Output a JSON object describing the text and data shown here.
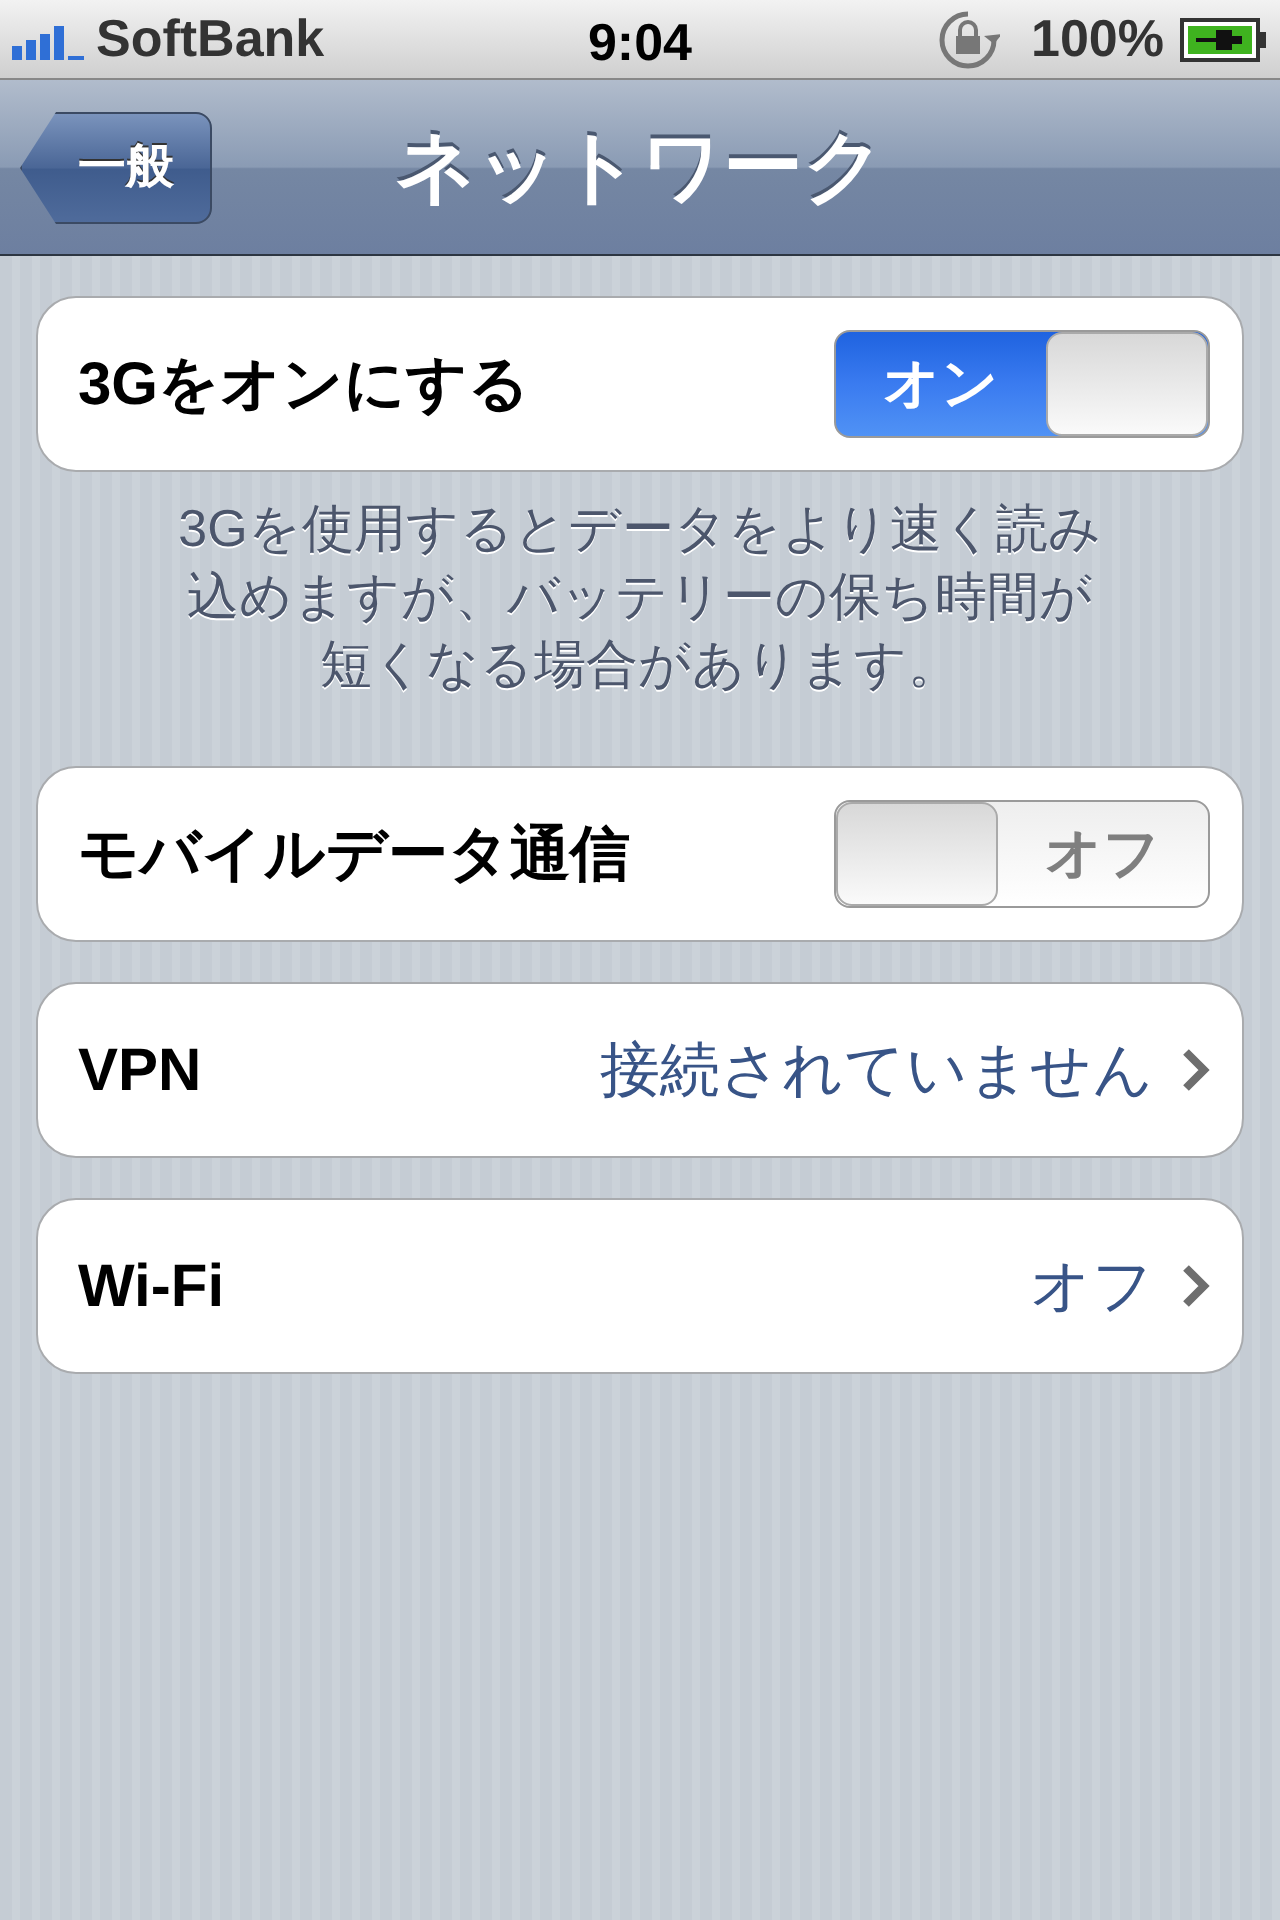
{
  "status_bar": {
    "carrier": "SoftBank",
    "time": "9:04",
    "battery": "100%"
  },
  "nav_bar": {
    "back": "一般",
    "title": "ネットワーク"
  },
  "groups": [
    {
      "rows": [
        {
          "kind": "toggle",
          "label": "3Gをオンにする",
          "on": true,
          "state_text": "オン"
        }
      ],
      "footer": "3Gを使用するとデータをより速く読み込めますが、バッテリーの保ち時間が短くなる場合があります。"
    },
    {
      "rows": [
        {
          "kind": "toggle",
          "label": "モバイルデータ通信",
          "on": false,
          "state_text": "オフ"
        }
      ]
    },
    {
      "rows": [
        {
          "kind": "link",
          "label": "VPN",
          "value": "接続されていません"
        }
      ]
    },
    {
      "rows": [
        {
          "kind": "link",
          "label": "Wi-Fi",
          "value": "オフ"
        }
      ]
    }
  ]
}
